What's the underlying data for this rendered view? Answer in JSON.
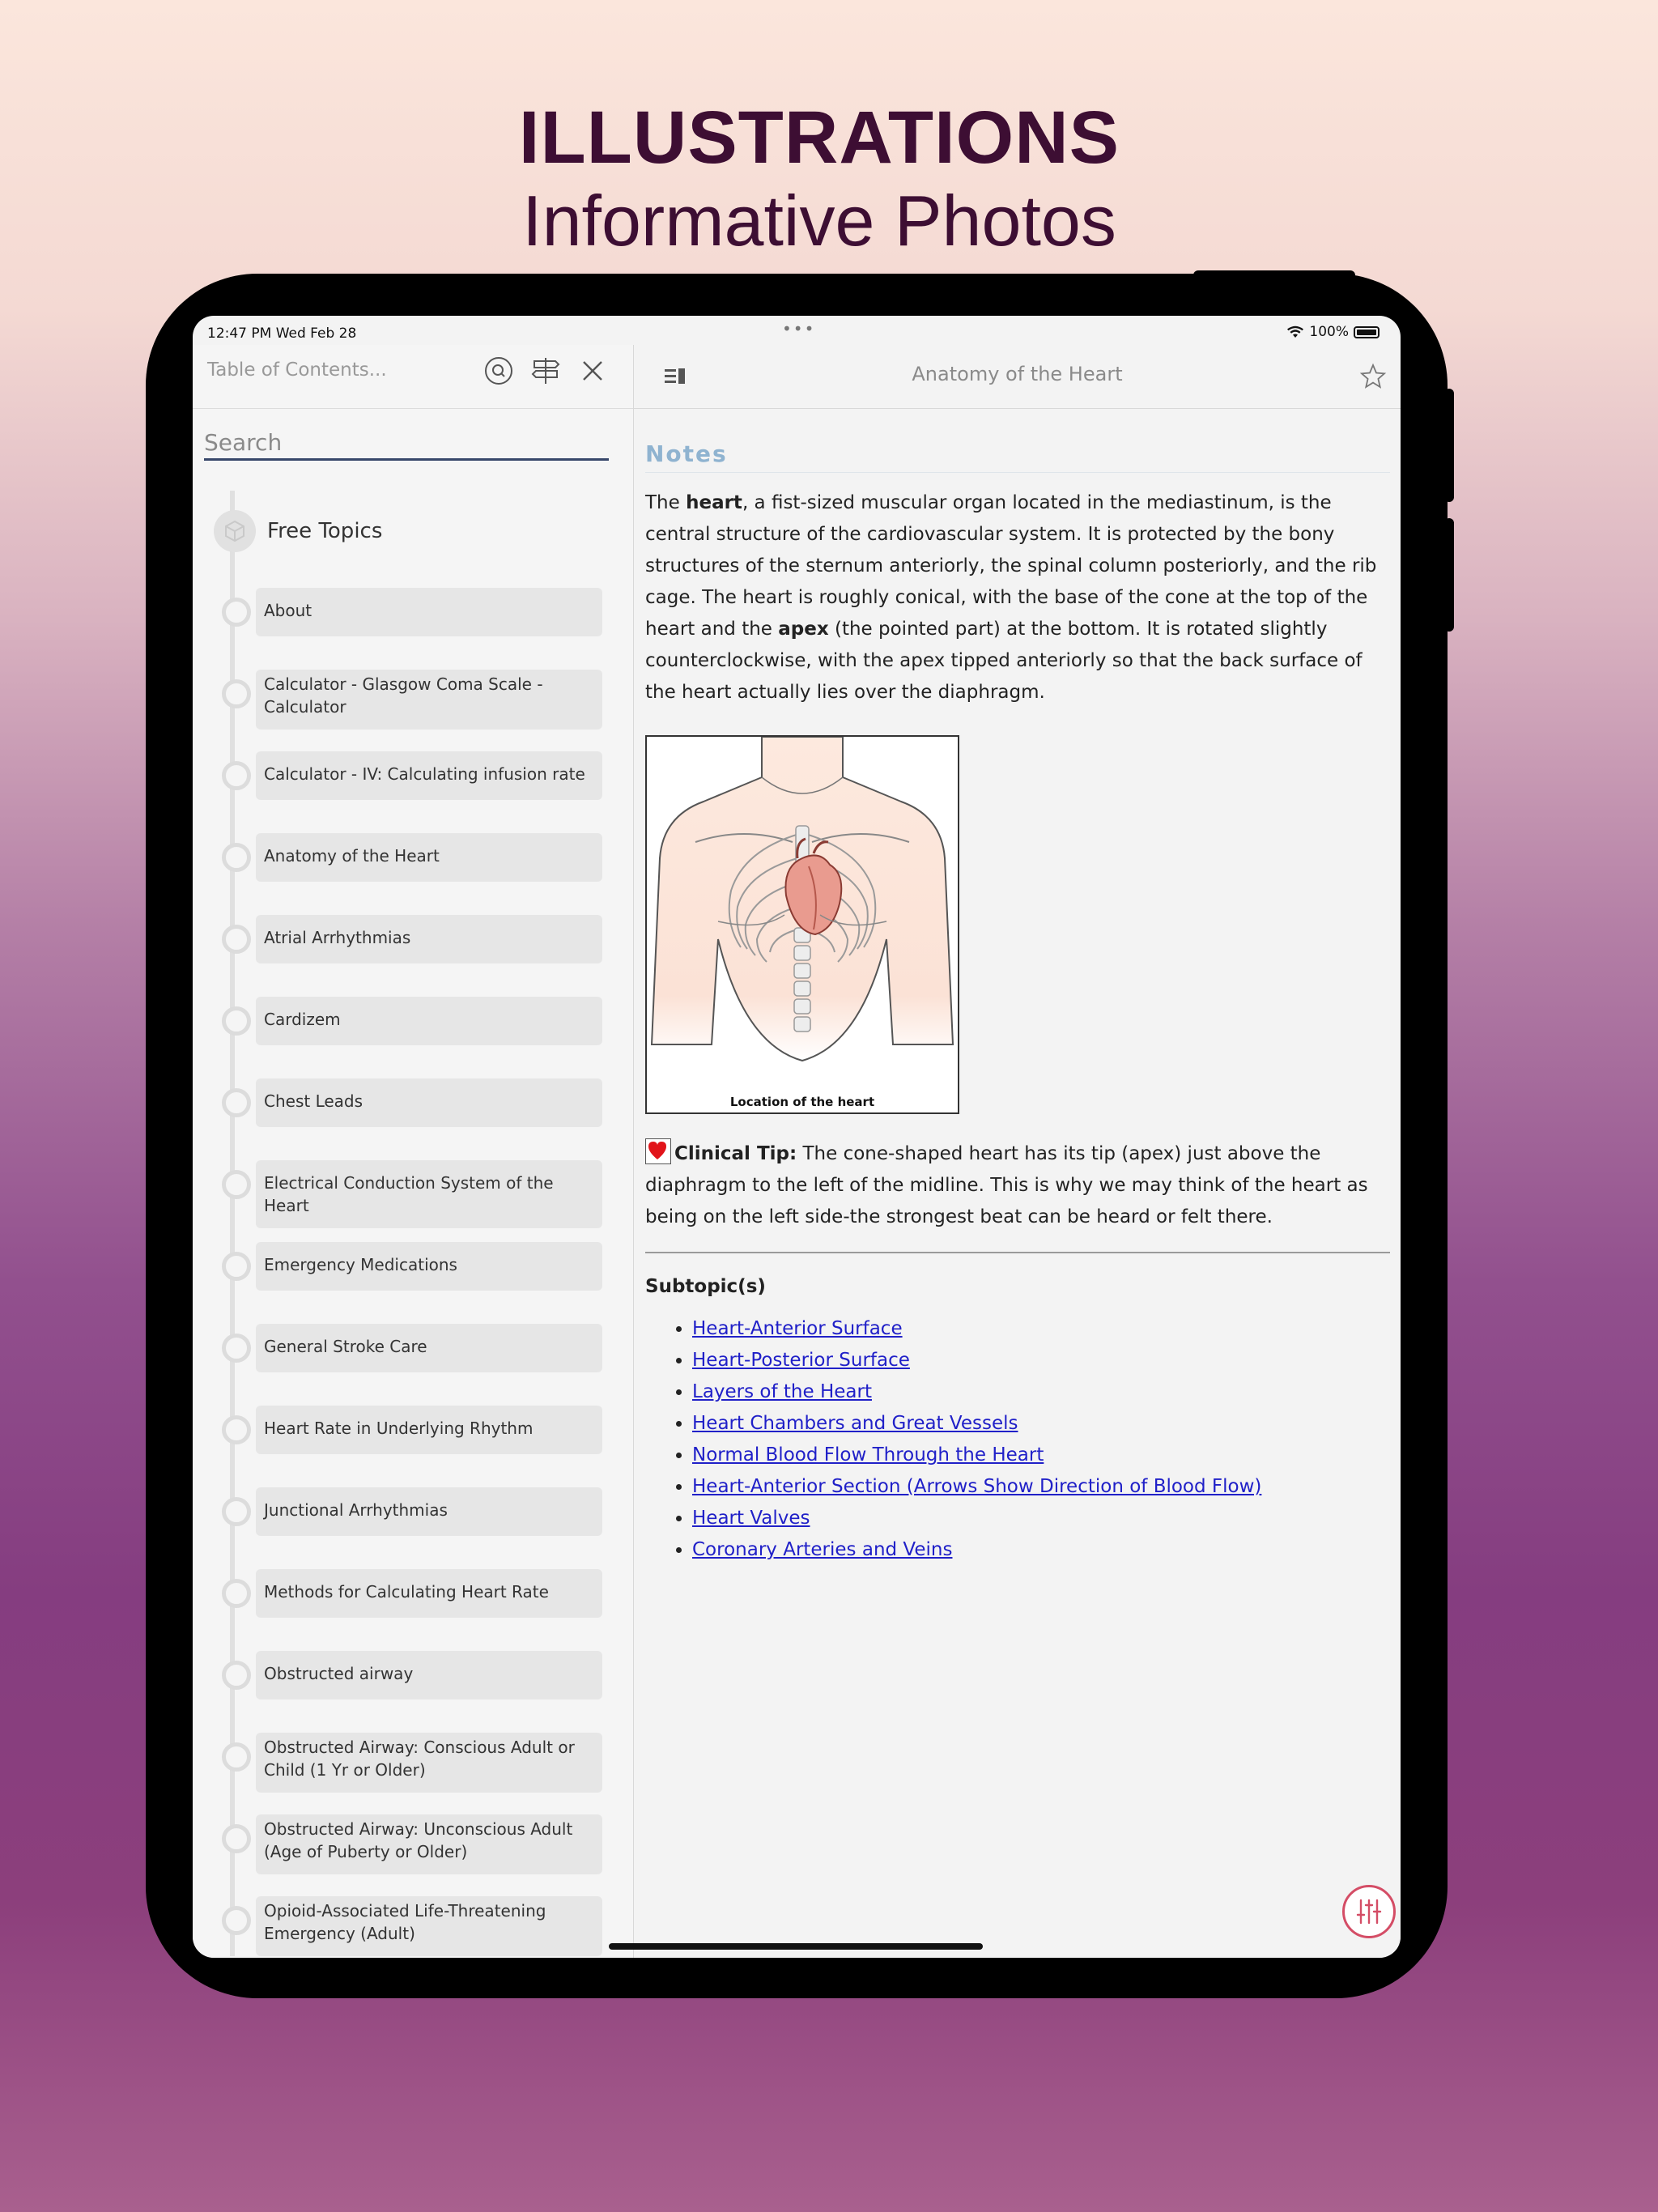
{
  "header": {
    "title": "ILLUSTRATIONS",
    "subtitle": "Informative Photos"
  },
  "status": {
    "time": "12:47 PM   Wed Feb 28",
    "battery": "100%"
  },
  "sidebar": {
    "placeholder": "Table of Contents...",
    "search_placeholder": "Search",
    "group": "Free Topics",
    "items": [
      "About",
      "Calculator - Glasgow Coma Scale - Calculator",
      "Calculator - IV: Calculating infusion rate",
      "Anatomy of the Heart",
      "Atrial Arrhythmias",
      "Cardizem",
      "Chest Leads",
      "Electrical Conduction System of the Heart",
      "Emergency Medications",
      "General Stroke Care",
      "Heart Rate in Underlying Rhythm",
      "Junctional Arrhythmias",
      "Methods for Calculating Heart Rate",
      "Obstructed airway",
      "Obstructed Airway: Conscious Adult or Child (1 Yr or Older)",
      "Obstructed Airway: Unconscious Adult (Age of Puberty or Older)",
      "Opioid-Associated Life-Threatening Emergency (Adult)"
    ]
  },
  "main": {
    "title": "Anatomy of the Heart",
    "notes_heading": "Notes",
    "p1": {
      "t1": "The ",
      "b1": "heart",
      "t2": ", a fist-sized muscular organ located in the mediastinum, is the central structure of the cardiovascular system. It is protected by the bony structures of the sternum anteriorly, the spinal column posteriorly, and the rib cage. The heart is roughly conical, with the base of the cone at the top of the heart and the ",
      "b2": "apex",
      "t3": " (the pointed part) at the bottom. It is rotated slightly counterclockwise, with the apex tipped anteriorly so that the back surface of the heart actually lies over the diaphragm."
    },
    "figure_caption": "Location of the heart",
    "tip": {
      "label": "Clinical Tip:",
      "text": " The cone-shaped heart has its tip (apex) just above the diaphragm to the left of the midline. This is why we may think of the heart as being on the left side-the strongest beat can be heard or felt there."
    },
    "subtopics_heading": "Subtopic(s)",
    "subtopics": [
      "Heart-Anterior Surface",
      "Heart-Posterior Surface",
      "Layers of the Heart",
      "Heart Chambers and Great Vessels",
      "Normal Blood Flow Through the Heart",
      "Heart-Anterior Section (Arrows Show Direction of Blood Flow)",
      "Heart Valves",
      "Coronary Arteries and Veins"
    ]
  },
  "icons": {
    "search": "search-circle-icon",
    "signpost": "signpost-icon",
    "close": "close-icon",
    "sidebar_toggle": "sidebar-toggle-icon",
    "favorite": "star-icon",
    "settings": "sliders-icon",
    "group": "cube-icon"
  },
  "colors": {
    "accent": "#3d0e33",
    "link": "#2020c8",
    "notes": "#8fb3d0",
    "fab": "#d44d66"
  }
}
